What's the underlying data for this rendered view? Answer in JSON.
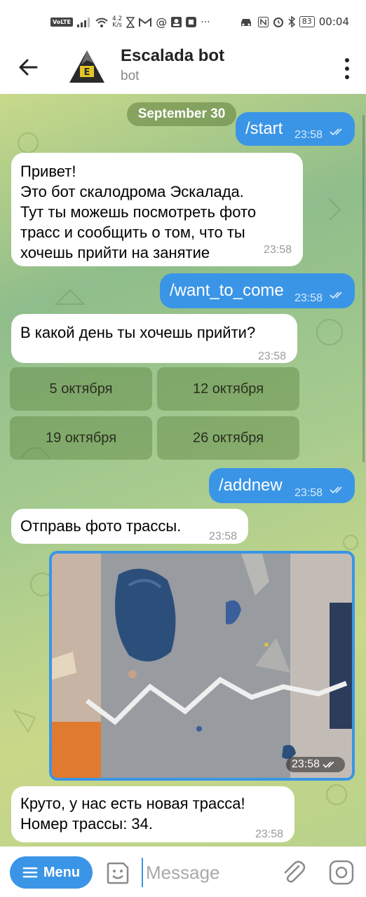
{
  "status_bar": {
    "volte": "VoLTE",
    "speed_value": "4.2",
    "speed_unit": "K/s",
    "battery": "83",
    "time": "00:04"
  },
  "header": {
    "title": "Escalada bot",
    "subtitle": "bot"
  },
  "chat": {
    "date_label": "September 30",
    "messages": [
      {
        "dir": "out",
        "text": "/start",
        "time": "23:58"
      },
      {
        "dir": "in",
        "text": "Привет!\nЭто бот скалодрома Эскалада.\nТут ты можешь посмотреть фото трасс и сообщить о том, что ты хочешь прийти на занятие",
        "time": "23:58"
      },
      {
        "dir": "out",
        "text": "/want_to_come",
        "time": "23:58"
      },
      {
        "dir": "in",
        "text": "В какой день ты хочешь прийти?",
        "time": "23:58"
      },
      {
        "dir": "out",
        "text": "/addnew",
        "time": "23:58"
      },
      {
        "dir": "in",
        "text": "Отправь фото трассы.",
        "time": "23:58"
      },
      {
        "dir": "out",
        "type": "photo",
        "time": "23:58"
      },
      {
        "dir": "in",
        "text": "Круто, у нас есть новая трасса!\nНомер трассы: 34.",
        "time": "23:58"
      }
    ],
    "keyboard": [
      "5 октября",
      "12 октября",
      "19 октября",
      "26 октября"
    ]
  },
  "input": {
    "menu_label": "Menu",
    "placeholder": "Message"
  },
  "colors": {
    "accent": "#3a95e6",
    "incoming_bubble": "#ffffff",
    "keyboard_button": "#8fae6a"
  }
}
